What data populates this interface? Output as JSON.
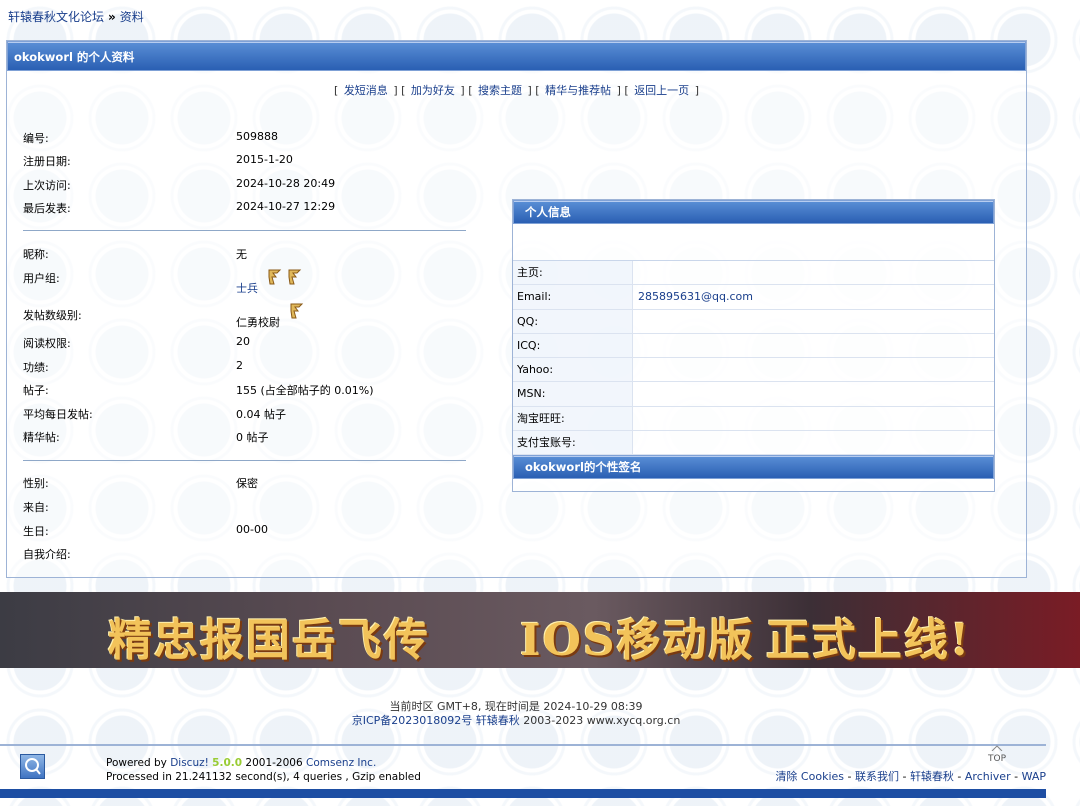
{
  "breadcrumb": {
    "site": "轩辕春秋文化论坛",
    "sep": "»",
    "current": "资料"
  },
  "profile": {
    "header_title": "okokworl 的个人资料",
    "actions": [
      "发短消息",
      "加为好友",
      "搜索主题",
      "精华与推荐帖",
      "返回上一页"
    ],
    "basic": [
      {
        "label": "编号:",
        "value": "509888"
      },
      {
        "label": "注册日期:",
        "value": "2015-1-20"
      },
      {
        "label": "上次访问:",
        "value": "2024-10-28 20:49"
      },
      {
        "label": "最后发表:",
        "value": "2024-10-27 12:29"
      }
    ],
    "nickname": {
      "label": "昵称:",
      "value": "无"
    },
    "usergroup": {
      "label": "用户组:",
      "value": "士兵"
    },
    "post_rank": {
      "label": "发帖数级别:",
      "value": "仁勇校尉"
    },
    "stats": [
      {
        "label": "阅读权限:",
        "value": "20"
      },
      {
        "label": "功绩:",
        "value": "2"
      },
      {
        "label": "帖子:",
        "value": "155 (占全部帖子的 0.01%)"
      },
      {
        "label": "平均每日发帖:",
        "value": "0.04 帖子"
      },
      {
        "label": "精华帖:",
        "value": "0 帖子"
      }
    ],
    "personal": [
      {
        "label": "性别:",
        "value": "保密"
      },
      {
        "label": "来自:",
        "value": ""
      },
      {
        "label": "生日:",
        "value": "00-00"
      },
      {
        "label": "自我介绍:",
        "value": ""
      }
    ]
  },
  "info_panel": {
    "title": "个人信息",
    "rows": [
      {
        "label": "主页:",
        "value": ""
      },
      {
        "label": "Email:",
        "value": "285895631@qq.com"
      },
      {
        "label": "QQ:",
        "value": ""
      },
      {
        "label": "ICQ:",
        "value": ""
      },
      {
        "label": "Yahoo:",
        "value": ""
      },
      {
        "label": "MSN:",
        "value": ""
      },
      {
        "label": "淘宝旺旺:",
        "value": ""
      },
      {
        "label": "支付宝账号:",
        "value": ""
      }
    ],
    "signature_title": "okokworl的个性签名"
  },
  "banner": {
    "part1": "精忠报国岳飞传",
    "part2": "IOS移动版",
    "part3": "正式上线!"
  },
  "footer": {
    "time_line": "当前时区 GMT+8, 现在时间是 2024-10-29 08:39",
    "icp": "京ICP备2023018092号",
    "site": "轩辕春秋",
    "copyright": "2003-2023 www.xycq.org.cn",
    "powered_prefix": "Powered by",
    "discuz": "Discuz!",
    "version": "5.0.0",
    "years": "2001-2006",
    "comsenz": "Comsenz Inc.",
    "processed": "Processed in 21.241132 second(s), 4 queries , Gzip enabled",
    "top": "TOP",
    "links": [
      "清除 Cookies",
      "联系我们",
      "轩辕春秋",
      "Archiver",
      "WAP"
    ]
  }
}
